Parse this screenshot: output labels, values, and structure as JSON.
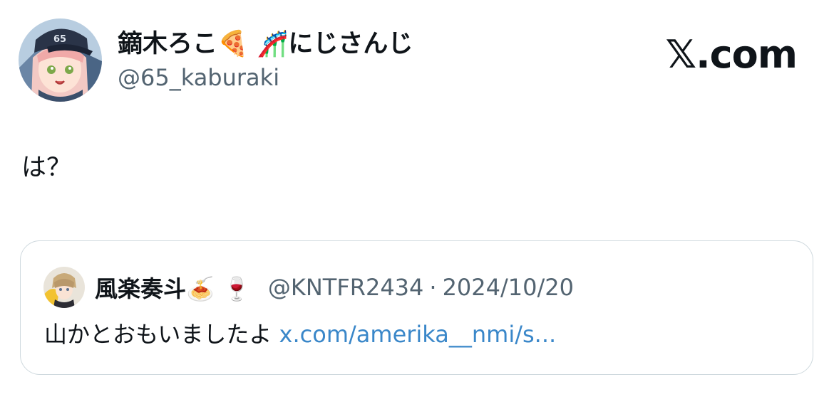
{
  "tweet": {
    "author": {
      "display_name": "鏑木ろこ🍕 🎢にじさんじ",
      "handle": "@65_kaburaki",
      "avatar_icon": "avatar-image"
    },
    "site_logo": "𝕏.com",
    "text": "は？"
  },
  "quoted_tweet": {
    "author": {
      "display_name": "風楽奏斗🍝 🍷",
      "handle": "@KNTFR2434",
      "avatar_icon": "avatar-image"
    },
    "separator": "·",
    "date": "2024/10/20",
    "text": "山かとおもいましたよ",
    "link_text": "x.com/amerika__nmi/s..."
  },
  "colors": {
    "text": "#0f1419",
    "secondary_text": "#536471",
    "link": "#3a87c9",
    "border": "#cfd9de"
  }
}
